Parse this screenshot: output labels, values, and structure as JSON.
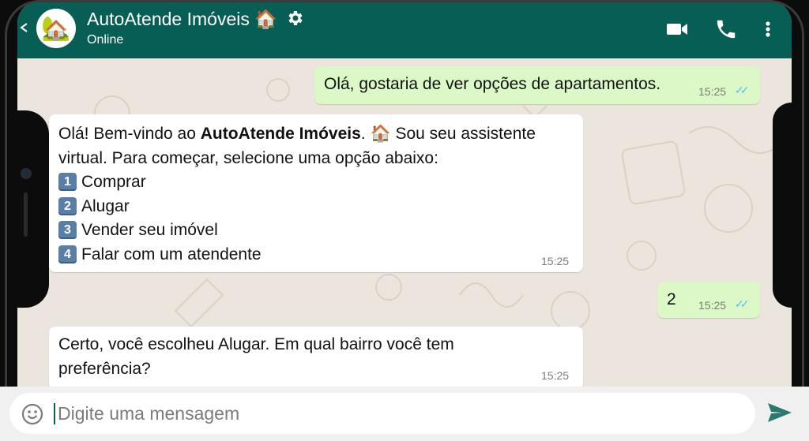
{
  "header": {
    "title": "AutoAtende Imóveis 🏠",
    "status": "Online",
    "avatar_emoji": "🏡",
    "icons": [
      "back-arrow-icon",
      "gear-icon",
      "video-call-icon",
      "phone-icon",
      "more-options-icon"
    ],
    "bg_color": "#075e54"
  },
  "messages": [
    {
      "direction": "outgoing",
      "text": "Olá, gostaria de ver opções de apartamentos.",
      "time": "15:25",
      "ticks": "✓✓"
    },
    {
      "direction": "incoming",
      "intro_prefix": "Olá! Bem-vindo ao ",
      "intro_bold": "AutoAtende Imóveis",
      "intro_suffix": ". 🏠 Sou seu assistente",
      "line2": "virtual. Para começar, selecione uma opção abaixo:",
      "options": [
        {
          "key": "1",
          "label": "Comprar"
        },
        {
          "key": "2",
          "label": "Alugar"
        },
        {
          "key": "3",
          "label": "Vender seu imóvel"
        },
        {
          "key": "4",
          "label": "Falar com um atendente"
        }
      ],
      "time": "15:25"
    },
    {
      "direction": "outgoing",
      "text": "2",
      "time": "15:25",
      "ticks": "✓✓"
    },
    {
      "direction": "incoming",
      "line1": "Certo, você escolheu Alugar. Em qual bairro você tem",
      "line2": "preferência?",
      "time": "15:25"
    }
  ],
  "composer": {
    "placeholder": "Digite uma mensagem",
    "icons": [
      "emoji-icon",
      "send-icon"
    ]
  },
  "colors": {
    "outgoing_bubble": "#dcf8c6",
    "incoming_bubble": "#ffffff",
    "read_ticks": "#4fc3f7",
    "wallpaper": "#ece5dd"
  }
}
